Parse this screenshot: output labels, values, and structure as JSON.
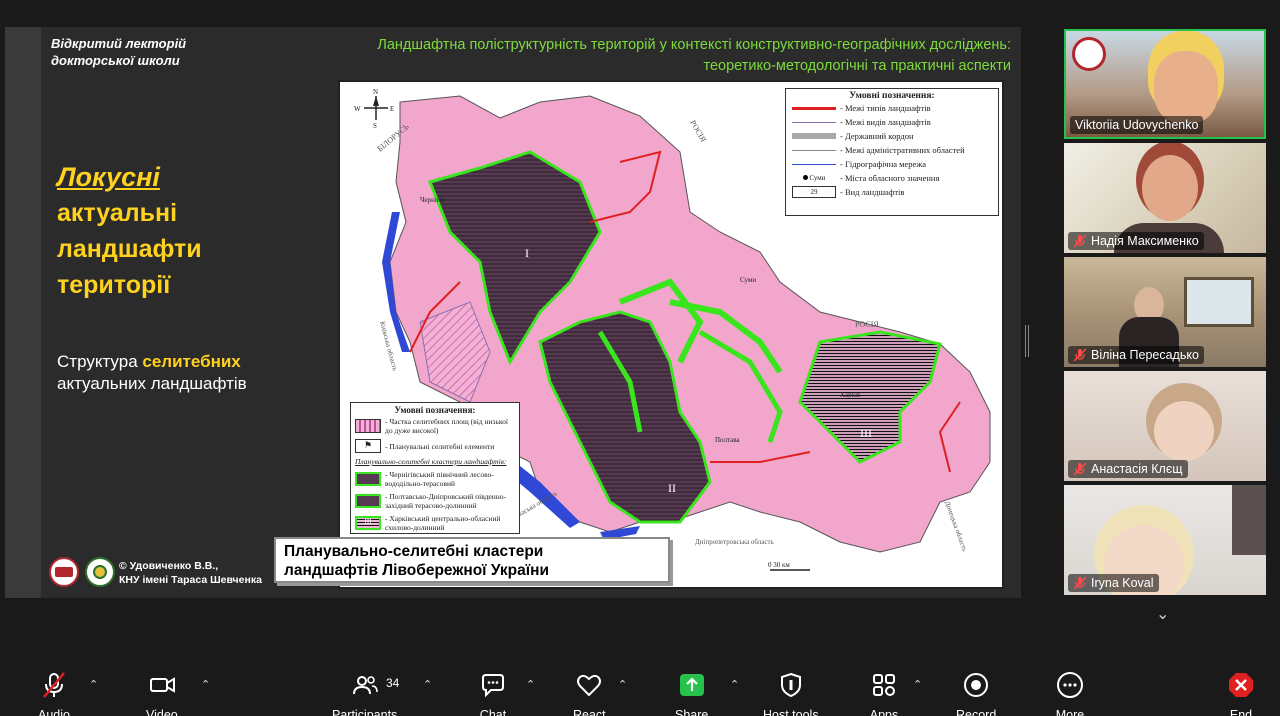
{
  "slide": {
    "lecture_title": [
      "Відкритий лекторій",
      "докторської школи"
    ],
    "header": [
      "Ландшафтна поліструктурність територій у контексті конструктивно-географічних досліджень:",
      "теоретико-методологічні та практичні аспекти"
    ],
    "main_heading": {
      "line1": "Локусні",
      "line2": "актуальні",
      "line3": "ландшафти",
      "line4": "території"
    },
    "structure": {
      "prefix": "Структура ",
      "accent": "селитебних",
      "line2": "актуальних ландшафтів"
    },
    "copyright": [
      "© Удовиченко В.В.,",
      "КНУ імені Тараса Шевченка"
    ],
    "caption": [
      "Планувально-селитебні кластери",
      "ландшафтів Лівобережної України"
    ]
  },
  "map": {
    "labels": {
      "belarus": "БІЛОРУСЬ",
      "russia_n": "РОСІЯ",
      "russia_e": "РОСІЯ",
      "chernihiv": "Чернігів",
      "sumy": "Суми",
      "poltava": "Полтава",
      "kharkiv": "Харків",
      "kyiv_obl": "Київська область",
      "cherkasy_obl": "Черкаська область",
      "dnipro_obl": "Дніпропетровська область",
      "donetsk_obl": "Донецька область",
      "cluster1": "І",
      "cluster2": "ІІ",
      "cluster3": "ІІІ",
      "scale": "0    30 км",
      "compass_n": "N",
      "compass_s": "S",
      "compass_w": "W",
      "compass_e": "E"
    },
    "legend_top": {
      "title": "Умовні позначення:",
      "items": [
        "- Межі типів ландшафтів",
        "- Межі видів ландшафтів",
        "- Державний кордон",
        "- Межі адміністративних областей",
        "- Гідрографічна мережа",
        "- Міста обласного значення",
        "- Вид ландшафтів"
      ],
      "city_sample": "Суми",
      "number_sample": "29"
    },
    "legend_bottom": {
      "title": "Умовні позначення:",
      "item1": "- Частка селитебних площ (від низької до дуже високої)",
      "item2": "- Планувальні селитебні елементи",
      "subtitle": "Планувально-селитебні кластери ландшафтів:",
      "c1": "- Чернігівський північний лесово-вододільно-терасовий",
      "c2": "- Полтавсько-Дніпровський південно-західний терасово-долинний",
      "c3": "- Харківський центрально-обласний схилово-долинний",
      "c3_num": "ІІІ"
    }
  },
  "participants": [
    {
      "name": "Viktoriia Udovychenko",
      "muted": false,
      "active": true
    },
    {
      "name": "Надія Максименко",
      "muted": true,
      "active": false
    },
    {
      "name": "Віліна Пересадько",
      "muted": true,
      "active": false
    },
    {
      "name": "Анастасія Клєщ",
      "muted": true,
      "active": false
    },
    {
      "name": "Iryna Koval",
      "muted": true,
      "active": false
    }
  ],
  "toolbar": {
    "audio": "Audio",
    "video": "Video",
    "participants": "Participants",
    "participants_count": "34",
    "chat": "Chat",
    "react": "React",
    "share": "Share",
    "host_tools": "Host tools",
    "apps": "Apps",
    "record": "Record",
    "more": "More",
    "end": "End"
  },
  "colors": {
    "accent_yellow": "#ffd21f",
    "header_green": "#7ddc3a",
    "share_green": "#27c24c",
    "end_red": "#e02020",
    "map_pink": "#f2a6cc",
    "cluster_dark": "#5a3d55",
    "cluster_outline": "#39e51c"
  }
}
